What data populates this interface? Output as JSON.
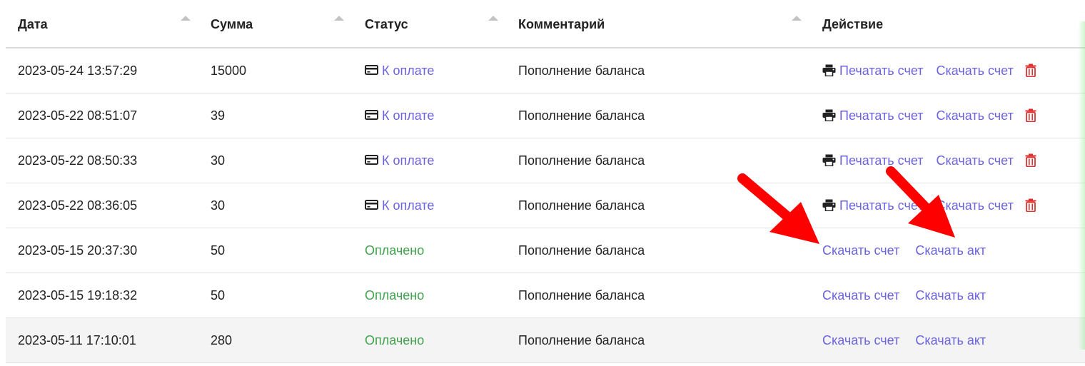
{
  "table": {
    "columns": [
      {
        "label": "Дата",
        "sortable": true
      },
      {
        "label": "Сумма",
        "sortable": true
      },
      {
        "label": "Статус",
        "sortable": true
      },
      {
        "label": "Комментарий",
        "sortable": true
      },
      {
        "label": "Действие",
        "sortable": false
      }
    ],
    "rows": [
      {
        "date": "2023-05-24 13:57:29",
        "sum": "15000",
        "status": "К оплате",
        "comment": "Пополнение баланса",
        "actions": {
          "print": "Печатать счет",
          "download_invoice": "Скачать счет"
        }
      },
      {
        "date": "2023-05-22 08:51:07",
        "sum": "39",
        "status": "К оплате",
        "comment": "Пополнение баланса",
        "actions": {
          "print": "Печатать счет",
          "download_invoice": "Скачать счет"
        }
      },
      {
        "date": "2023-05-22 08:50:33",
        "sum": "30",
        "status": "К оплате",
        "comment": "Пополнение баланса",
        "actions": {
          "print": "Печатать счет",
          "download_invoice": "Скачать счет"
        }
      },
      {
        "date": "2023-05-22 08:36:05",
        "sum": "30",
        "status": "К оплате",
        "comment": "Пополнение баланса",
        "actions": {
          "print": "Печатать счет",
          "download_invoice": "Скачать счет"
        }
      },
      {
        "date": "2023-05-15 20:37:30",
        "sum": "50",
        "status": "Оплачено",
        "comment": "Пополнение баланса",
        "actions": {
          "download_invoice": "Скачать счет",
          "download_act": "Скачать акт"
        }
      },
      {
        "date": "2023-05-15 19:18:32",
        "sum": "50",
        "status": "Оплачено",
        "comment": "Пополнение баланса",
        "actions": {
          "download_invoice": "Скачать счет",
          "download_act": "Скачать акт"
        }
      },
      {
        "date": "2023-05-11 17:10:01",
        "sum": "280",
        "status": "Оплачено",
        "comment": "Пополнение баланса",
        "actions": {
          "download_invoice": "Скачать счет",
          "download_act": "Скачать акт"
        }
      }
    ]
  },
  "icons": {
    "status_pending": "credit-card-icon",
    "print": "printer-icon",
    "delete": "trash-icon"
  },
  "colors": {
    "link": "#6b63e0",
    "paid": "#3fa34d",
    "delete": "#e03131",
    "annotation_arrow": "#ff0000"
  }
}
